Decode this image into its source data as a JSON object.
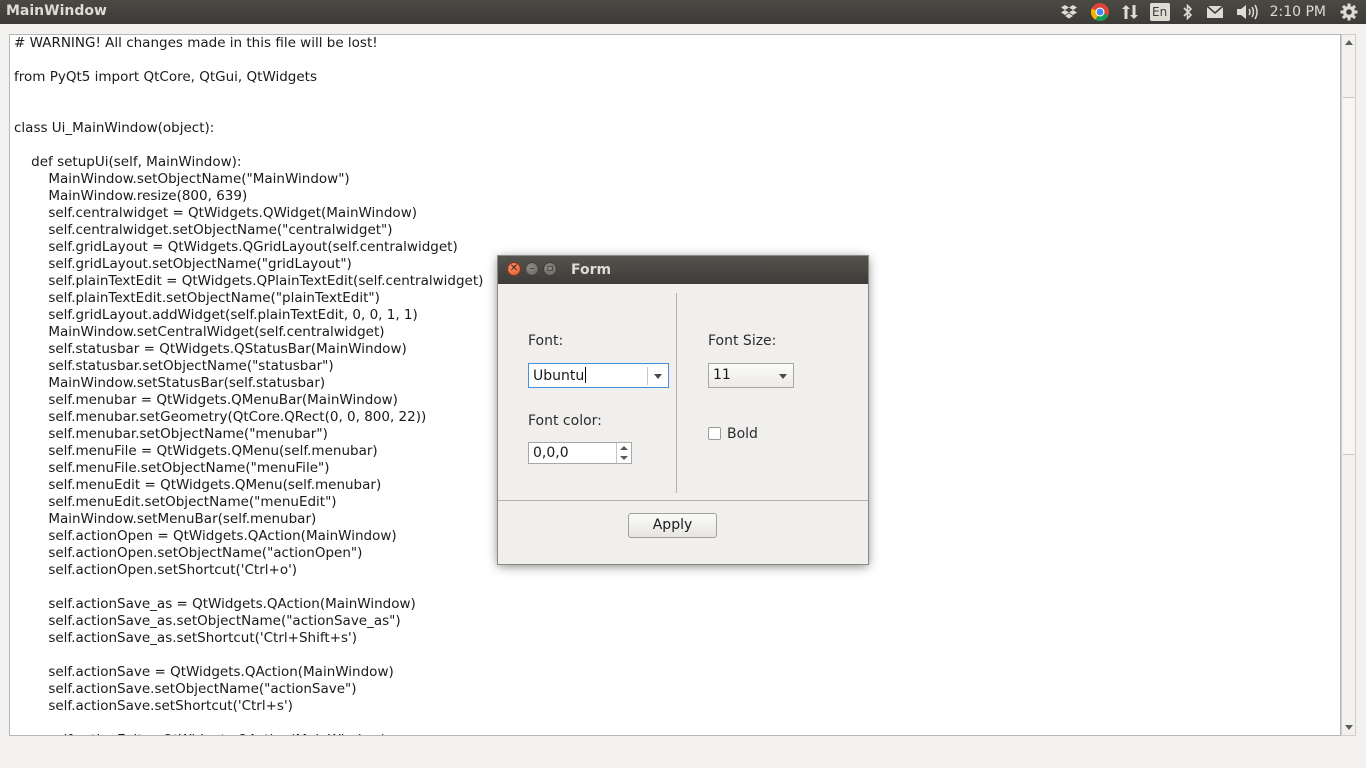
{
  "top_panel": {
    "title": "MainWindow",
    "tray": {
      "language": "En",
      "time": "2:10 PM"
    },
    "icons": [
      "dropbox-icon",
      "chrome-icon",
      "network-icon",
      "keyboard-language-icon",
      "bluetooth-icon",
      "mail-icon",
      "volume-icon",
      "settings-gear-icon"
    ]
  },
  "editor": {
    "lines": [
      "# WARNING! All changes made in this file will be lost!",
      "",
      "from PyQt5 import QtCore, QtGui, QtWidgets",
      "",
      "",
      "class Ui_MainWindow(object):",
      "",
      "    def setupUi(self, MainWindow):",
      "        MainWindow.setObjectName(\"MainWindow\")",
      "        MainWindow.resize(800, 639)",
      "        self.centralwidget = QtWidgets.QWidget(MainWindow)",
      "        self.centralwidget.setObjectName(\"centralwidget\")",
      "        self.gridLayout = QtWidgets.QGridLayout(self.centralwidget)",
      "        self.gridLayout.setObjectName(\"gridLayout\")",
      "        self.plainTextEdit = QtWidgets.QPlainTextEdit(self.centralwidget)",
      "        self.plainTextEdit.setObjectName(\"plainTextEdit\")",
      "        self.gridLayout.addWidget(self.plainTextEdit, 0, 0, 1, 1)",
      "        MainWindow.setCentralWidget(self.centralwidget)",
      "        self.statusbar = QtWidgets.QStatusBar(MainWindow)",
      "        self.statusbar.setObjectName(\"statusbar\")",
      "        MainWindow.setStatusBar(self.statusbar)",
      "        self.menubar = QtWidgets.QMenuBar(MainWindow)",
      "        self.menubar.setGeometry(QtCore.QRect(0, 0, 800, 22))",
      "        self.menubar.setObjectName(\"menubar\")",
      "        self.menuFile = QtWidgets.QMenu(self.menubar)",
      "        self.menuFile.setObjectName(\"menuFile\")",
      "        self.menuEdit = QtWidgets.QMenu(self.menubar)",
      "        self.menuEdit.setObjectName(\"menuEdit\")",
      "        MainWindow.setMenuBar(self.menubar)",
      "        self.actionOpen = QtWidgets.QAction(MainWindow)",
      "        self.actionOpen.setObjectName(\"actionOpen\")",
      "        self.actionOpen.setShortcut('Ctrl+o')",
      "",
      "        self.actionSave_as = QtWidgets.QAction(MainWindow)",
      "        self.actionSave_as.setObjectName(\"actionSave_as\")",
      "        self.actionSave_as.setShortcut('Ctrl+Shift+s')",
      "",
      "        self.actionSave = QtWidgets.QAction(MainWindow)",
      "        self.actionSave.setObjectName(\"actionSave\")",
      "        self.actionSave.setShortcut('Ctrl+s')",
      "",
      "        self.actionExit = QtWidgets.QAction(MainWindow)"
    ]
  },
  "dialog": {
    "title": "Form",
    "font_label": "Font:",
    "font_value": "Ubuntu",
    "font_size_label": "Font Size:",
    "font_size_value": "11",
    "font_color_label": "Font color:",
    "font_color_value": "0,0,0",
    "bold_label": "Bold",
    "bold_checked": false,
    "apply_label": "Apply"
  }
}
